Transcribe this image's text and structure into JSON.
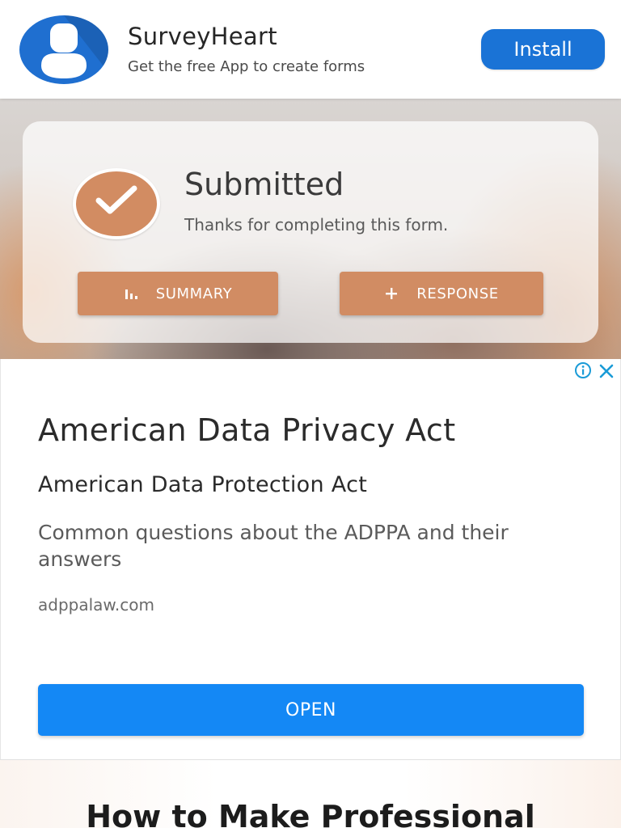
{
  "app_banner": {
    "logo_icon": "user-avatar-icon",
    "brand_color": "#1f6fd0",
    "name": "SurveyHeart",
    "tagline": "Get the free App to create forms",
    "install_label": "Install"
  },
  "confirmation": {
    "status_icon": "check-icon",
    "accent_color": "#d18c63",
    "title": "Submitted",
    "message": "Thanks for completing this form.",
    "summary_icon": "bar-chart-icon",
    "summary_label": "SUMMARY",
    "response_icon": "plus-icon",
    "response_label": "RESPONSE"
  },
  "ad": {
    "info_icon": "info-icon",
    "close_icon": "close-icon",
    "headline": "American Data Privacy Act",
    "subheadline": "American Data Protection Act",
    "description": "Common questions about the ADPPA and their answers",
    "url": "adppalaw.com",
    "cta_label": "OPEN",
    "cta_color": "#1488f5"
  },
  "promo": {
    "heading": "How to Make Professional"
  }
}
